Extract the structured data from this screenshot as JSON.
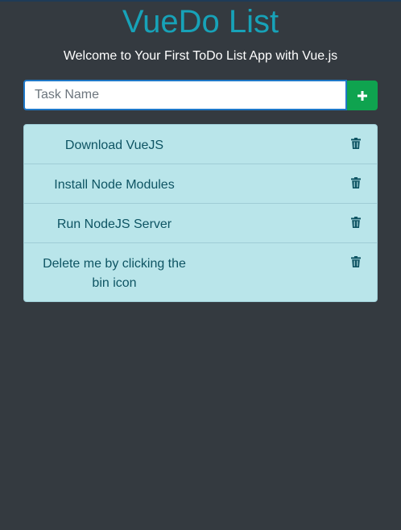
{
  "header": {
    "title": "VueDo List",
    "subtitle": "Welcome to Your First ToDo List App with Vue.js"
  },
  "new_task": {
    "placeholder": "Task Name",
    "value": "",
    "add_icon": "plus-icon"
  },
  "tasks": [
    {
      "label": "Download VueJS",
      "icon": "trash-icon"
    },
    {
      "label": "Install Node Modules",
      "icon": "trash-icon"
    },
    {
      "label": "Run NodeJS Server",
      "icon": "trash-icon"
    },
    {
      "label": "Delete me by clicking the bin icon",
      "icon": "trash-icon"
    }
  ],
  "colors": {
    "background": "#343a40",
    "title": "#17a2b8",
    "add_button": "#0fa34f",
    "list_background": "#b9e5ea",
    "task_text": "#0e5463"
  }
}
